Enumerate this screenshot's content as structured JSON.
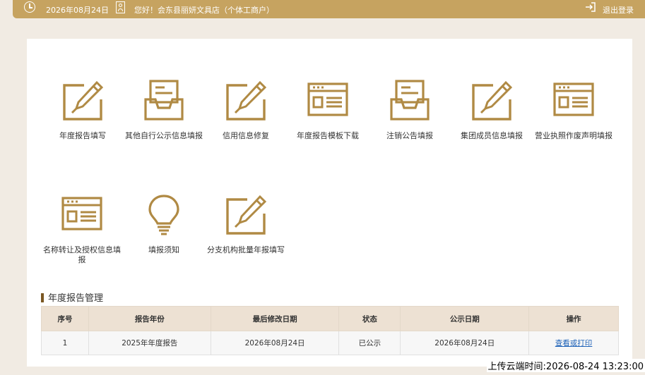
{
  "topbar": {
    "date": "2026年08月24日",
    "greeting": "您好！会东县丽妍文具店（个体工商户）",
    "logout": "退出登录"
  },
  "tiles": [
    {
      "label": "年度报告填写",
      "icon": "edit-icon"
    },
    {
      "label": "其他自行公示信息填报",
      "icon": "inbox-tray-icon"
    },
    {
      "label": "信用信息修复",
      "icon": "edit-icon"
    },
    {
      "label": "年度报告模板下载",
      "icon": "browser-window-icon"
    },
    {
      "label": "注销公告填报",
      "icon": "inbox-tray-icon"
    },
    {
      "label": "集团成员信息填报",
      "icon": "edit-icon"
    },
    {
      "label": "营业执照作废声明填报",
      "icon": "browser-window-icon"
    },
    {
      "label": "名称转让及授权信息填报",
      "icon": "browser-window-icon"
    },
    {
      "label": "填报须知",
      "icon": "lightbulb-icon"
    },
    {
      "label": "分支机构批量年报填写",
      "icon": "edit-icon"
    }
  ],
  "section": {
    "title": "年度报告管理"
  },
  "table": {
    "headers": [
      "序号",
      "报告年份",
      "最后修改日期",
      "状态",
      "公示日期",
      "操作"
    ],
    "rows": [
      {
        "index": "1",
        "year": "2025年年度报告",
        "modified": "2026年08月24日",
        "status": "已公示",
        "published": "2026年08月24日",
        "action": "查看或打印"
      }
    ]
  },
  "watermark": "上传云端时间:2026-08-24 13:23:00",
  "colors": {
    "gold": "#c6a360",
    "icon": "#b08a44",
    "link": "#1e62b8"
  }
}
